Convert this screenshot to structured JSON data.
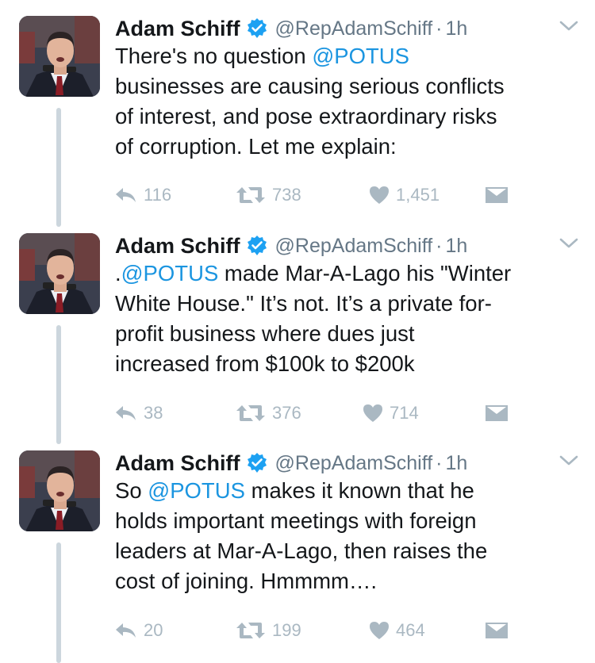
{
  "tweets": [
    {
      "author": {
        "name": "Adam Schiff",
        "handle": "@RepAdamSchiff",
        "time": "1h",
        "verified": true
      },
      "text_segments": [
        {
          "line": [
            "There's no question ",
            "@POTUS"
          ]
        },
        {
          "line": [
            "businesses are causing serious conflicts"
          ]
        },
        {
          "line": [
            "of interest, and pose extraordinary risks"
          ]
        },
        {
          "line": [
            "of corruption. Let me explain:"
          ]
        }
      ],
      "line1_prefix": "There's no question ",
      "line1_mention": "@POTUS",
      "line2": "businesses are causing serious conflicts",
      "line3": "of interest, and pose extraordinary risks",
      "line4": "of corruption. Let me explain:",
      "replies": "116",
      "retweets": "738",
      "likes": "1,451"
    },
    {
      "author": {
        "name": "Adam Schiff",
        "handle": "@RepAdamSchiff",
        "time": "1h",
        "verified": true
      },
      "line1_prefix": ".",
      "line1_mention": "@POTUS",
      "line1_suffix": " made Mar-A-Lago his \"Winter",
      "line2": "White House.\" It’s not. It’s a private for-",
      "line3": "profit business where dues just",
      "line4": "increased from $100k to $200k",
      "replies": "38",
      "retweets": "376",
      "likes": "714"
    },
    {
      "author": {
        "name": "Adam Schiff",
        "handle": "@RepAdamSchiff",
        "time": "1h",
        "verified": true
      },
      "line1_prefix": "So ",
      "line1_mention": "@POTUS",
      "line1_suffix": " makes it known that he",
      "line2": "holds important meetings with foreign",
      "line3": "leaders at Mar-A-Lago, then raises the",
      "line4": "cost of joining. Hmmmm….",
      "replies": "20",
      "retweets": "199",
      "likes": "464"
    }
  ],
  "colors": {
    "mention": "#1b95e0",
    "verified": "#1da1f2",
    "muted": "#657786",
    "action": "#aab8c2",
    "thread_line": "#ccd6dd"
  },
  "icons": {
    "reply": "reply-icon",
    "retweet": "retweet-icon",
    "like": "heart-icon",
    "dm": "envelope-icon",
    "caret": "chevron-down-icon",
    "verified": "verified-badge-icon"
  }
}
